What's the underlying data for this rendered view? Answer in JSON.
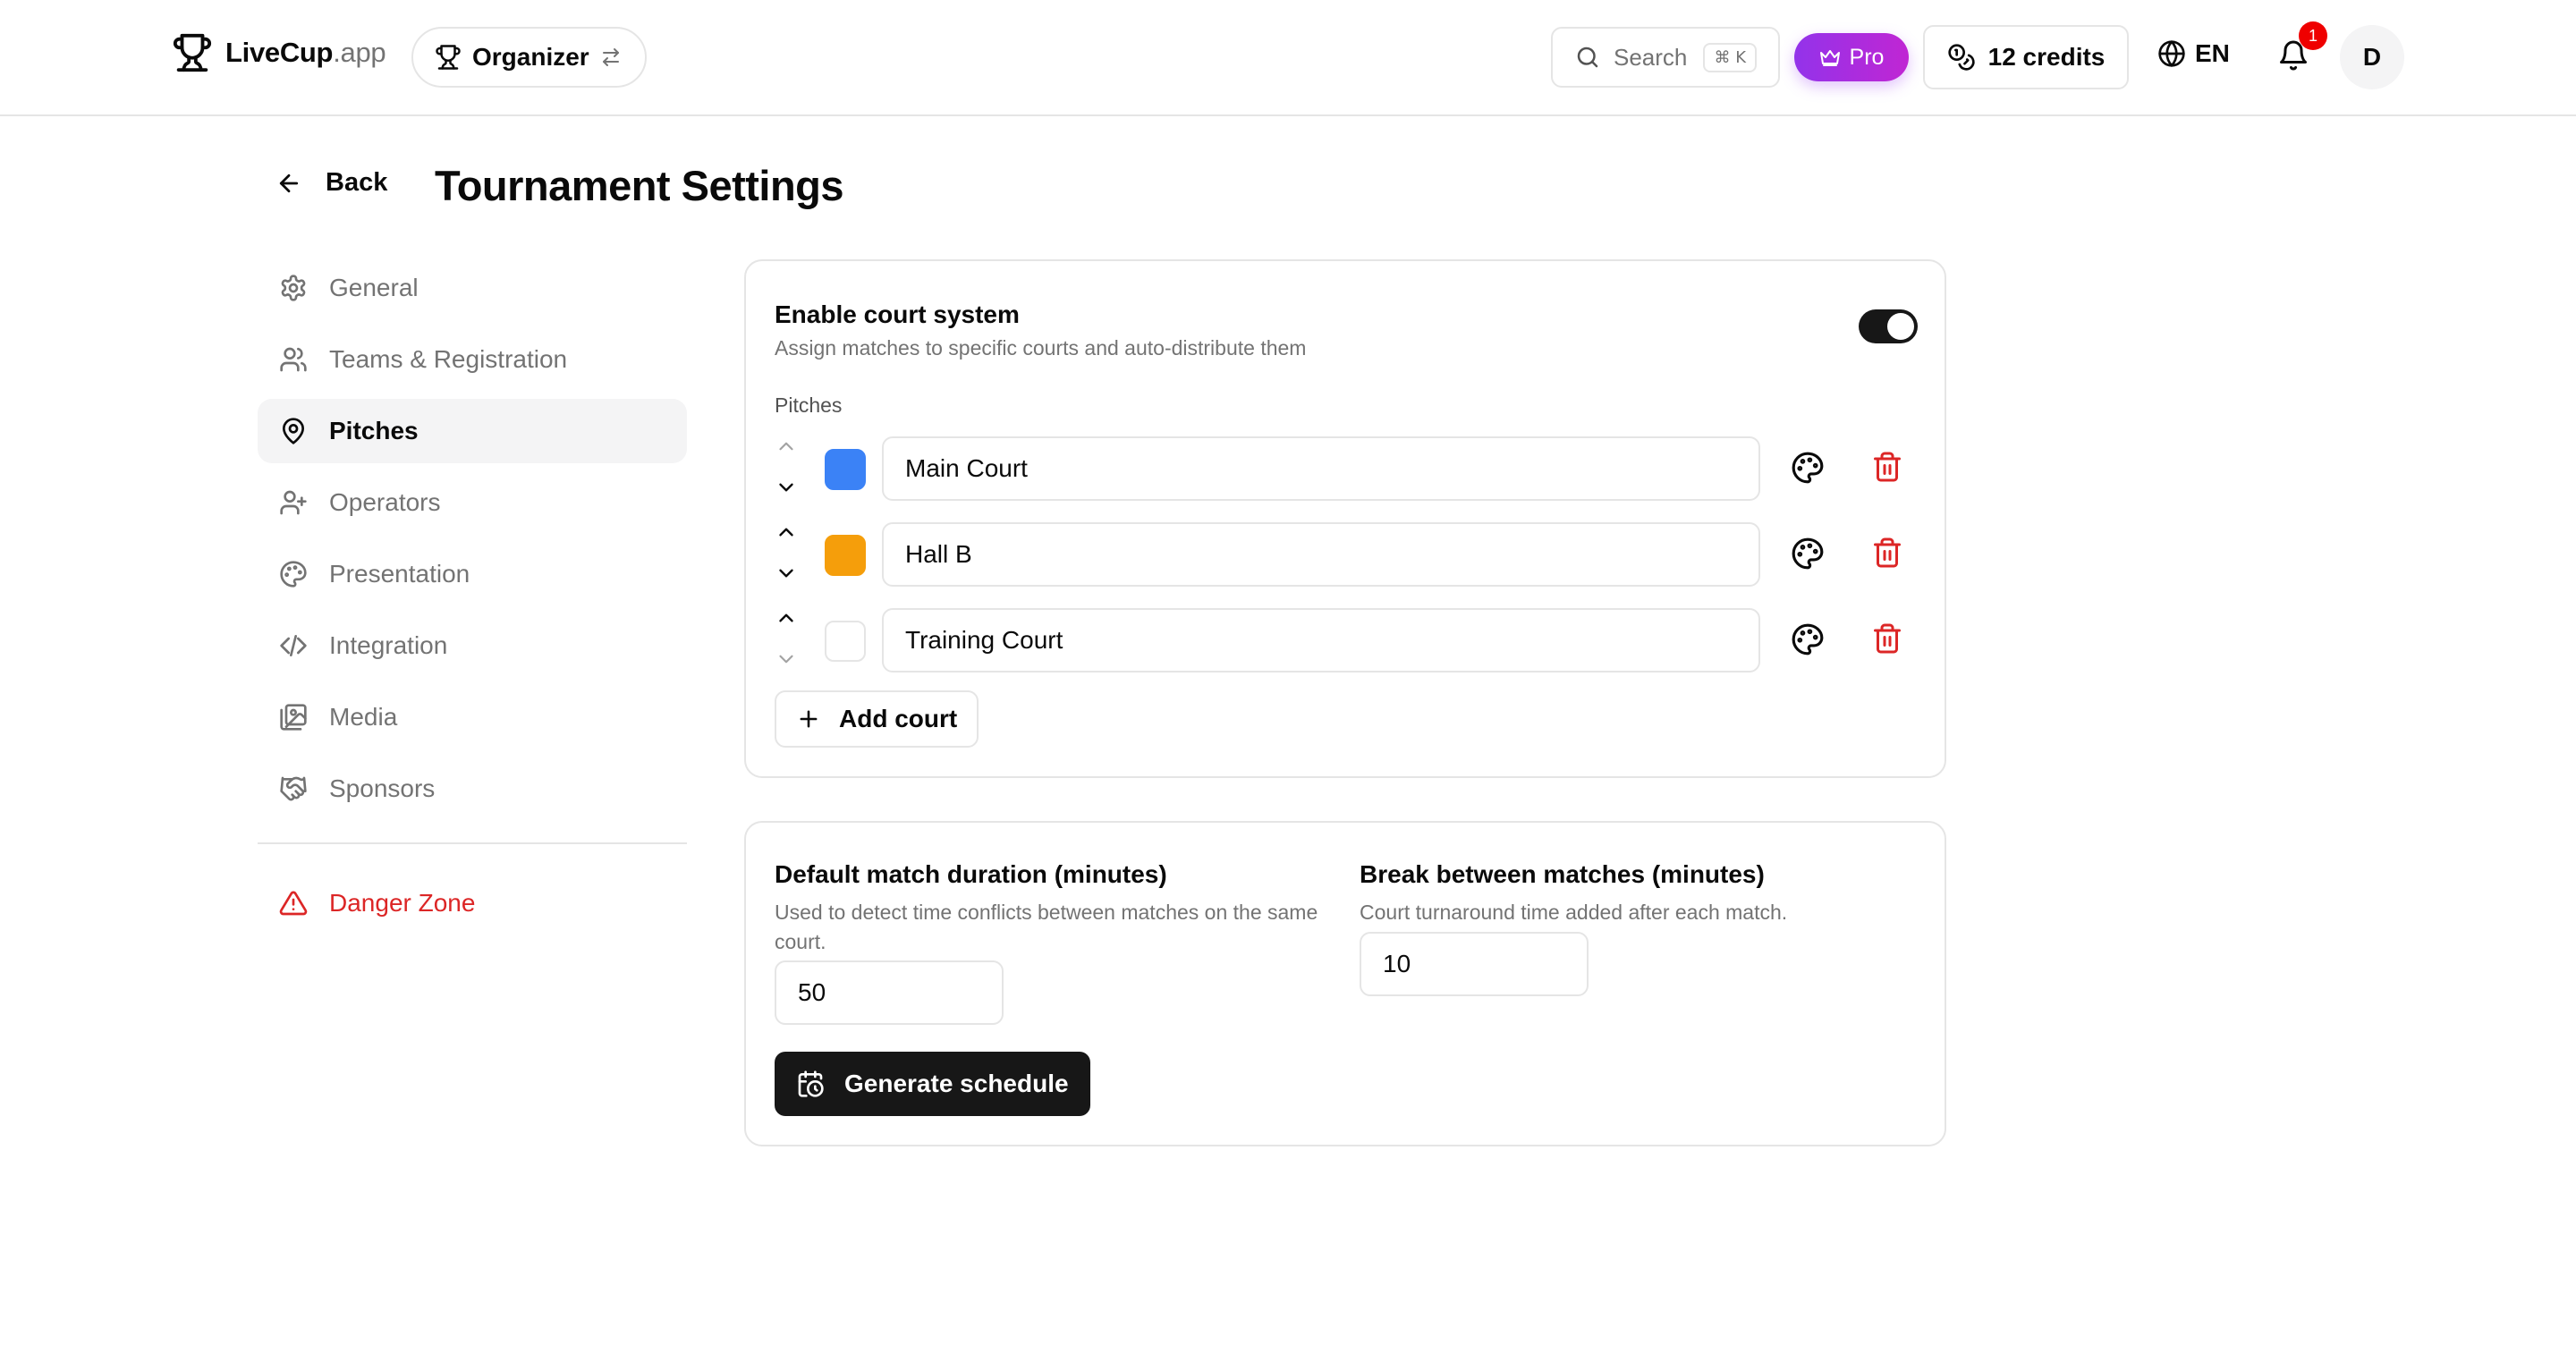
{
  "header": {
    "logo_text": "LiveCup",
    "logo_suffix": ".app",
    "role_label": "Organizer",
    "search_placeholder": "Search",
    "search_shortcut": "⌘ K",
    "pro_label": "Pro",
    "credits_label": "12 credits",
    "language": "EN",
    "notification_count": "1",
    "avatar_initial": "D"
  },
  "page": {
    "back_label": "Back",
    "title": "Tournament Settings"
  },
  "sidebar": {
    "items": [
      {
        "label": "General",
        "icon": "gear-icon"
      },
      {
        "label": "Teams & Registration",
        "icon": "users-icon"
      },
      {
        "label": "Pitches",
        "icon": "map-pin-icon",
        "active": true
      },
      {
        "label": "Operators",
        "icon": "user-plus-icon"
      },
      {
        "label": "Presentation",
        "icon": "palette-icon"
      },
      {
        "label": "Integration",
        "icon": "code-icon"
      },
      {
        "label": "Media",
        "icon": "images-icon"
      },
      {
        "label": "Sponsors",
        "icon": "handshake-icon"
      }
    ],
    "danger_label": "Danger Zone"
  },
  "court_system": {
    "toggle_title": "Enable court system",
    "toggle_description": "Assign matches to specific courts and auto-distribute them",
    "enabled": true,
    "pitches_label": "Pitches",
    "courts": [
      {
        "name": "Main Court",
        "color": "#3b82f6"
      },
      {
        "name": "Hall B",
        "color": "#f59e0b"
      },
      {
        "name": "Training Court",
        "color": "#ffffff"
      }
    ],
    "add_court_label": "Add court"
  },
  "schedule": {
    "duration_title": "Default match duration (minutes)",
    "duration_description": "Used to detect time conflicts between matches on the same court.",
    "duration_value": "50",
    "break_title": "Break between matches (minutes)",
    "break_description": "Court turnaround time added after each match.",
    "break_value": "10",
    "generate_label": "Generate schedule"
  },
  "colors": {
    "danger": "#dc2626",
    "pro_gradient_start": "#9333ea",
    "pro_gradient_end": "#c026d3",
    "primary_dark": "#171717"
  }
}
